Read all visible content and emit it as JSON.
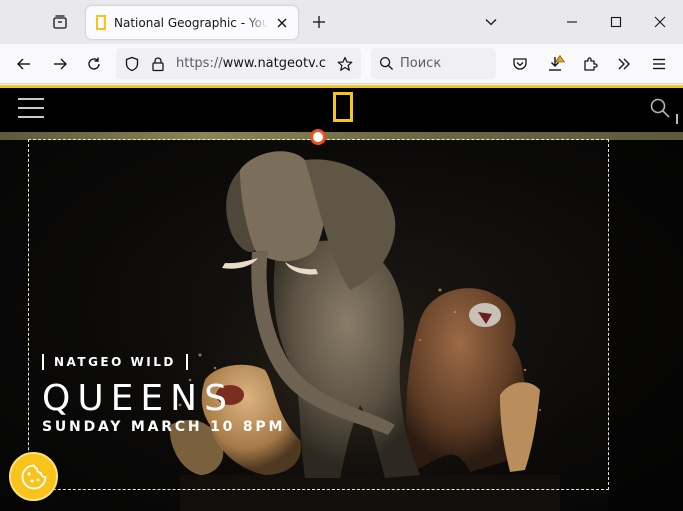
{
  "browser": {
    "tab": {
      "title": "National Geographic - Your favourite",
      "favicon_color": "#f8c31b"
    },
    "url": {
      "scheme": "https://",
      "host": "www.natgeotv.com"
    },
    "search": {
      "placeholder": "Поиск"
    },
    "icons": {
      "tab_list": "tab-list-icon",
      "close": "close-icon",
      "new_tab": "plus-icon",
      "list_all_tabs": "chevron-down-icon",
      "minimize": "minimize-icon",
      "maximize": "maximize-icon",
      "window_close": "window-close-icon",
      "back": "back-arrow-icon",
      "forward": "forward-arrow-icon",
      "reload": "reload-icon",
      "tracking_protection": "shield-icon",
      "site_security": "lock-icon",
      "bookmark": "star-icon",
      "search": "search-icon",
      "pocket": "pocket-icon",
      "downloads": "download-icon",
      "extensions": "puzzle-icon",
      "overflow": "double-chevron-icon",
      "menu": "hamburger-menu-icon"
    }
  },
  "site": {
    "brand_color": "#f8c31b",
    "hero": {
      "channel": "NATGEO WILD",
      "title": "QUEENS",
      "air_date": "SUNDAY MARCH 10 8PM"
    }
  }
}
